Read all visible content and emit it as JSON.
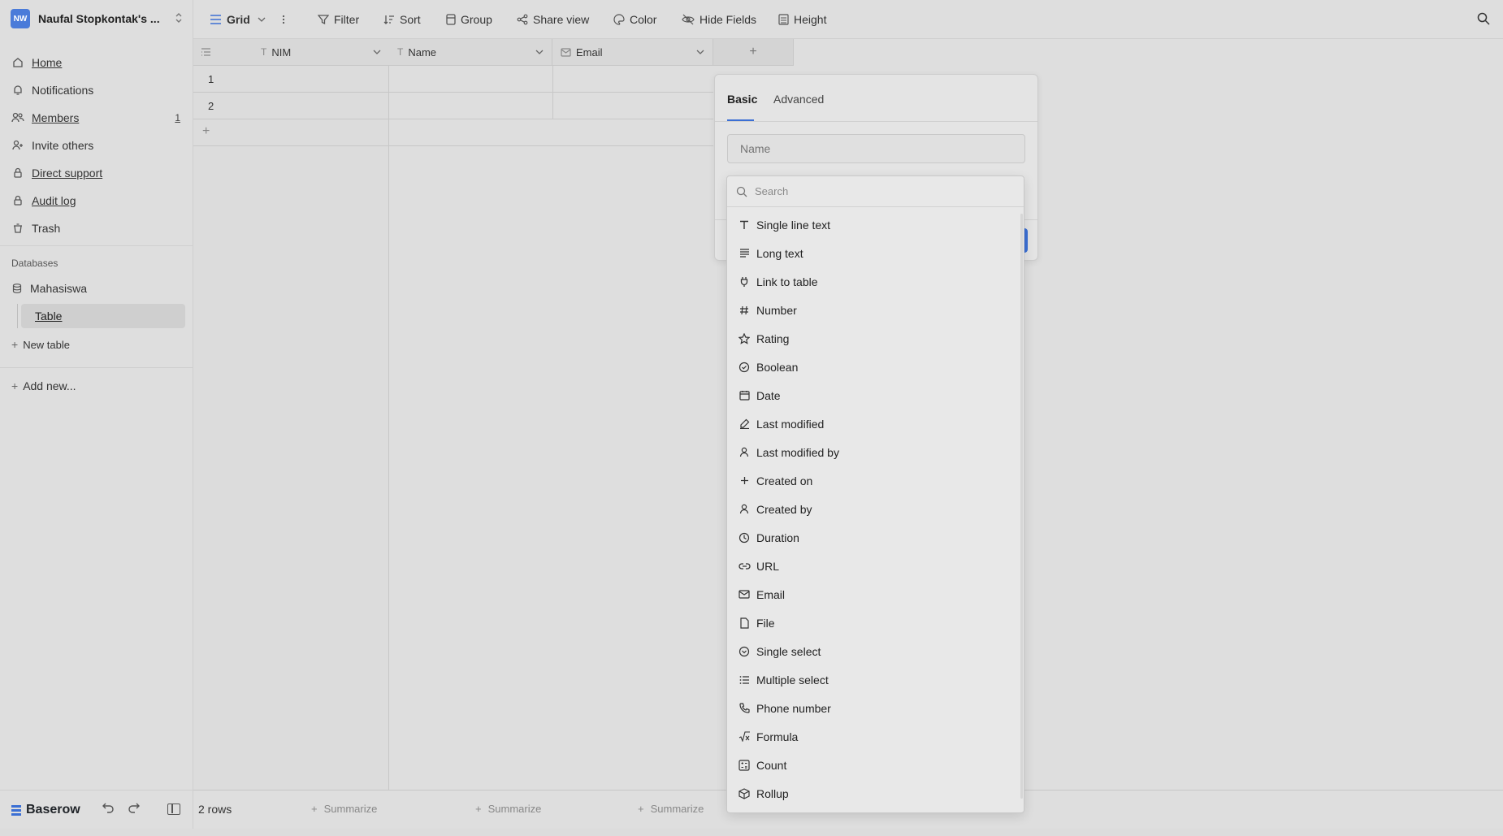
{
  "workspace": {
    "initials": "NW",
    "name": "Naufal Stopkontak's ..."
  },
  "sidebar": {
    "items": [
      {
        "label": "Home",
        "icon": "home-icon"
      },
      {
        "label": "Notifications",
        "icon": "bell-icon"
      },
      {
        "label": "Members",
        "icon": "members-icon",
        "count": "1"
      },
      {
        "label": "Invite others",
        "icon": "invite-icon"
      },
      {
        "label": "Direct support",
        "icon": "lock-icon"
      },
      {
        "label": "Audit log",
        "icon": "lock-icon"
      },
      {
        "label": "Trash",
        "icon": "trash-icon"
      }
    ],
    "section_label": "Databases",
    "database": "Mahasiswa",
    "table": "Table",
    "new_table": "New table",
    "add_new": "Add new...",
    "brand": "Baserow"
  },
  "toolbar": {
    "view": "Grid",
    "filter": "Filter",
    "sort": "Sort",
    "group": "Group",
    "share_view": "Share view",
    "color": "Color",
    "hide_fields": "Hide Fields",
    "height": "Height"
  },
  "grid": {
    "columns": [
      "NIM",
      "Name",
      "Email"
    ],
    "rows": [
      "1",
      "2"
    ],
    "add_column": "+",
    "footer_rows": "2 rows",
    "summarize": "Summarize"
  },
  "field_popover": {
    "tabs": [
      "Basic",
      "Advanced"
    ],
    "name_placeholder": "Name"
  },
  "field_types": {
    "search_placeholder": "Search",
    "items": [
      {
        "label": "Single line text",
        "icon": "text-icon"
      },
      {
        "label": "Long text",
        "icon": "long-text-icon"
      },
      {
        "label": "Link to table",
        "icon": "plug-icon"
      },
      {
        "label": "Number",
        "icon": "hash-icon"
      },
      {
        "label": "Rating",
        "icon": "star-icon"
      },
      {
        "label": "Boolean",
        "icon": "check-circle-icon"
      },
      {
        "label": "Date",
        "icon": "calendar-icon"
      },
      {
        "label": "Last modified",
        "icon": "edit-icon"
      },
      {
        "label": "Last modified by",
        "icon": "user-icon"
      },
      {
        "label": "Created on",
        "icon": "plus-icon"
      },
      {
        "label": "Created by",
        "icon": "user-icon"
      },
      {
        "label": "Duration",
        "icon": "clock-icon"
      },
      {
        "label": "URL",
        "icon": "link-icon"
      },
      {
        "label": "Email",
        "icon": "mail-icon"
      },
      {
        "label": "File",
        "icon": "file-icon"
      },
      {
        "label": "Single select",
        "icon": "chevron-circle-icon"
      },
      {
        "label": "Multiple select",
        "icon": "list-icon"
      },
      {
        "label": "Phone number",
        "icon": "phone-icon"
      },
      {
        "label": "Formula",
        "icon": "formula-icon"
      },
      {
        "label": "Count",
        "icon": "count-icon"
      },
      {
        "label": "Rollup",
        "icon": "box-icon"
      }
    ]
  }
}
